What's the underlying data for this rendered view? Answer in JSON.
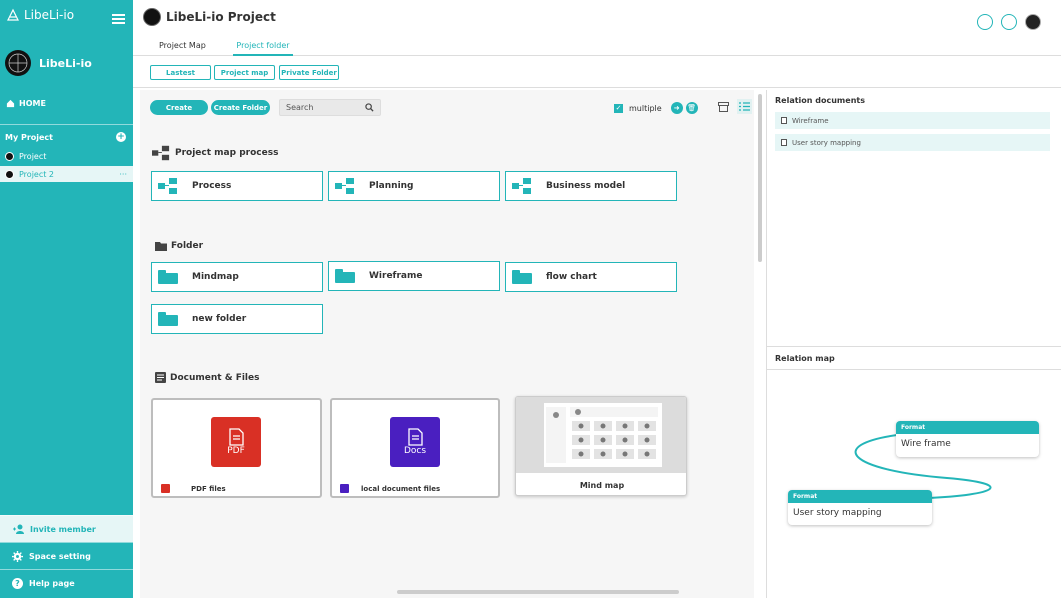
{
  "app": {
    "name": "LibeLi-io",
    "space_name": "LibeLi-io"
  },
  "sidebar": {
    "home": "HOME",
    "my_project": "My Project",
    "projects": [
      {
        "label": "Project"
      },
      {
        "label": "Project 2",
        "more": "···"
      }
    ],
    "bottom": {
      "invite": "Invite member",
      "space_setting": "Space setting",
      "help": "Help page"
    }
  },
  "header": {
    "title": "LibeLi-io Project"
  },
  "tabs": [
    {
      "label": "Project Map"
    },
    {
      "label": "Project folder"
    }
  ],
  "filters": [
    {
      "label": "Lastest"
    },
    {
      "label": "Project map"
    },
    {
      "label": "Private Folder"
    }
  ],
  "toolbar": {
    "create": "Create",
    "create_folder": "Create Folder",
    "search_placeholder": "Search",
    "multiple": "multiple",
    "multiple_checked": true
  },
  "sections": {
    "project_map": {
      "title": "Project map process",
      "items": [
        "Process",
        "Planning",
        "Business model"
      ]
    },
    "folder": {
      "title": "Folder",
      "items": [
        "Mindmap",
        "Wireframe",
        "flow chart",
        "new folder"
      ]
    },
    "documents": {
      "title": "Document & Files",
      "items": [
        {
          "label": "PDF files",
          "icon_text": "PDF"
        },
        {
          "label": "local document files",
          "icon_text": "Docs"
        },
        {
          "label": "Mind map"
        }
      ]
    }
  },
  "right_panel": {
    "relation_documents_title": "Relation documents",
    "relation_documents": [
      "Wireframe",
      "User story mapping"
    ],
    "relation_map_title": "Relation map",
    "nodes": [
      {
        "head": "Format",
        "label": "Wire frame"
      },
      {
        "head": "Format",
        "label": "User story mapping"
      }
    ]
  },
  "colors": {
    "accent": "#23b5b8",
    "pdf": "#d93025",
    "docs": "#4a1fc0"
  }
}
